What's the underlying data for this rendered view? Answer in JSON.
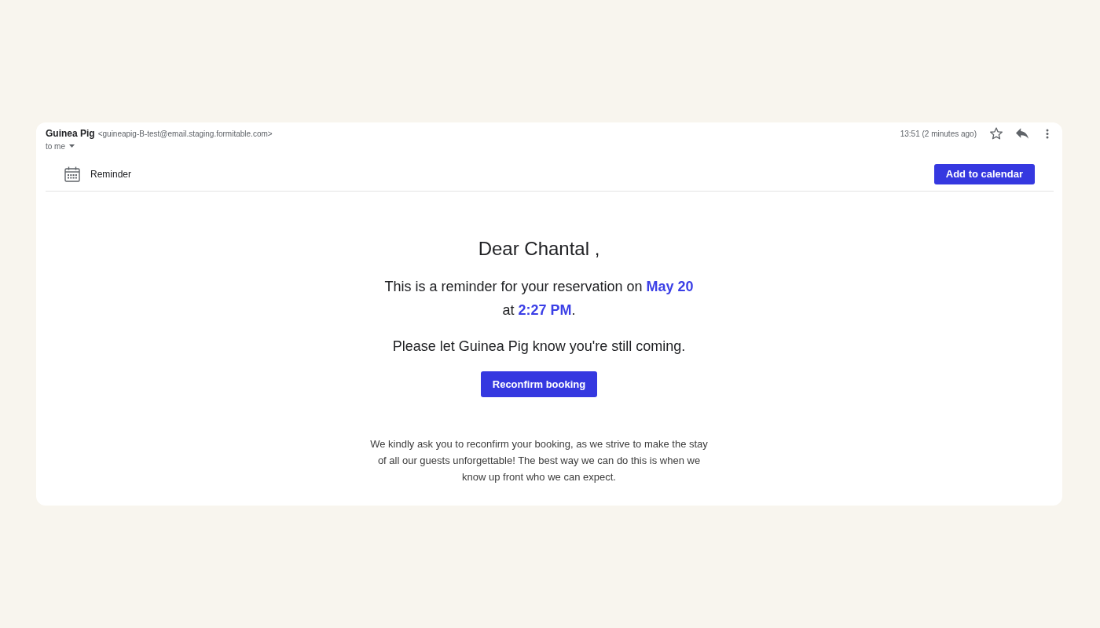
{
  "email": {
    "sender_name": "Guinea Pig",
    "sender_address": "<guineapig-B-test@email.staging.formitable.com>",
    "recipients": "to me",
    "time": "13:51 (2 minutes ago)",
    "starred": false
  },
  "event_bar": {
    "label": "Reminder",
    "button": "Add to calendar"
  },
  "body": {
    "greeting": "Dear Chantal ,",
    "reminder": "This is a reminder for your reservation on **May 20** at **2:27 PM**.",
    "prompt": "Please let Guinea Pig know you're still coming.",
    "button": "Reconfirm booking",
    "note": "We kindly ask you to reconfirm your booking, as we strive to make the stay of all our guests unforgettable! The best way we can do this is when we know up front who we can expect."
  }
}
